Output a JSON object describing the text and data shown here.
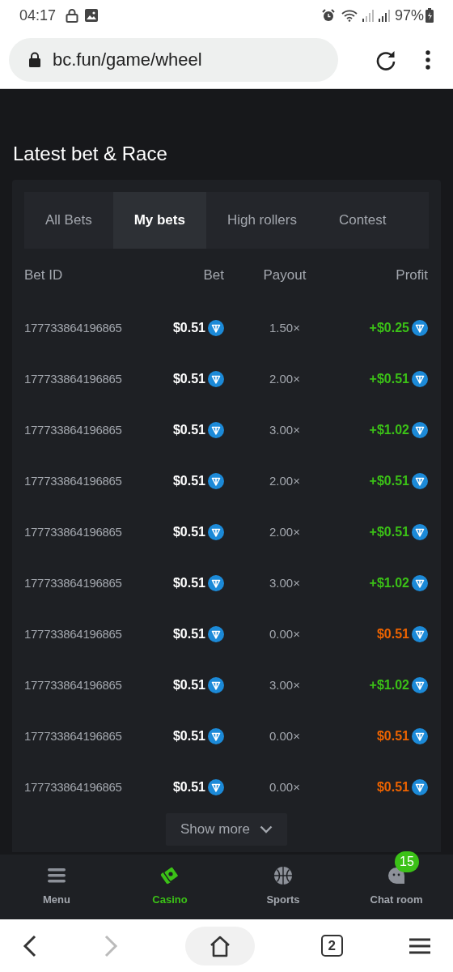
{
  "status_bar": {
    "time": "04:17",
    "battery": "97%"
  },
  "address_bar": {
    "url": "bc.fun/game/wheel"
  },
  "section_title": "Latest bet & Race",
  "tabs": [
    {
      "label": "All Bets",
      "selected": false
    },
    {
      "label": "My bets",
      "selected": true
    },
    {
      "label": "High rollers",
      "selected": false
    },
    {
      "label": "Contest",
      "selected": false
    }
  ],
  "table": {
    "columns": [
      "Bet ID",
      "Bet",
      "Payout",
      "Profit"
    ],
    "rows": [
      {
        "bet_id": "177733864196865",
        "bet": "$0.51",
        "payout": "1.50×",
        "profit": "+$0.25",
        "kind": "win"
      },
      {
        "bet_id": "177733864196865",
        "bet": "$0.51",
        "payout": "2.00×",
        "profit": "+$0.51",
        "kind": "win"
      },
      {
        "bet_id": "177733864196865",
        "bet": "$0.51",
        "payout": "3.00×",
        "profit": "+$1.02",
        "kind": "win"
      },
      {
        "bet_id": "177733864196865",
        "bet": "$0.51",
        "payout": "2.00×",
        "profit": "+$0.51",
        "kind": "win"
      },
      {
        "bet_id": "177733864196865",
        "bet": "$0.51",
        "payout": "2.00×",
        "profit": "+$0.51",
        "kind": "win"
      },
      {
        "bet_id": "177733864196865",
        "bet": "$0.51",
        "payout": "3.00×",
        "profit": "+$1.02",
        "kind": "win"
      },
      {
        "bet_id": "177733864196865",
        "bet": "$0.51",
        "payout": "0.00×",
        "profit": "$0.51",
        "kind": "loss"
      },
      {
        "bet_id": "177733864196865",
        "bet": "$0.51",
        "payout": "3.00×",
        "profit": "+$1.02",
        "kind": "win"
      },
      {
        "bet_id": "177733864196865",
        "bet": "$0.51",
        "payout": "0.00×",
        "profit": "$0.51",
        "kind": "loss"
      },
      {
        "bet_id": "177733864196865",
        "bet": "$0.51",
        "payout": "0.00×",
        "profit": "$0.51",
        "kind": "loss"
      }
    ]
  },
  "show_more": "Show more",
  "bottom_nav": [
    {
      "label": "Menu",
      "kind": "menu",
      "selected": false
    },
    {
      "label": "Casino",
      "kind": "casino",
      "selected": true
    },
    {
      "label": "Sports",
      "kind": "sports",
      "selected": false
    },
    {
      "label": "Chat room",
      "kind": "chat",
      "selected": false,
      "badge": "15"
    }
  ],
  "browser_toolbar": {
    "tab_count": "2"
  }
}
